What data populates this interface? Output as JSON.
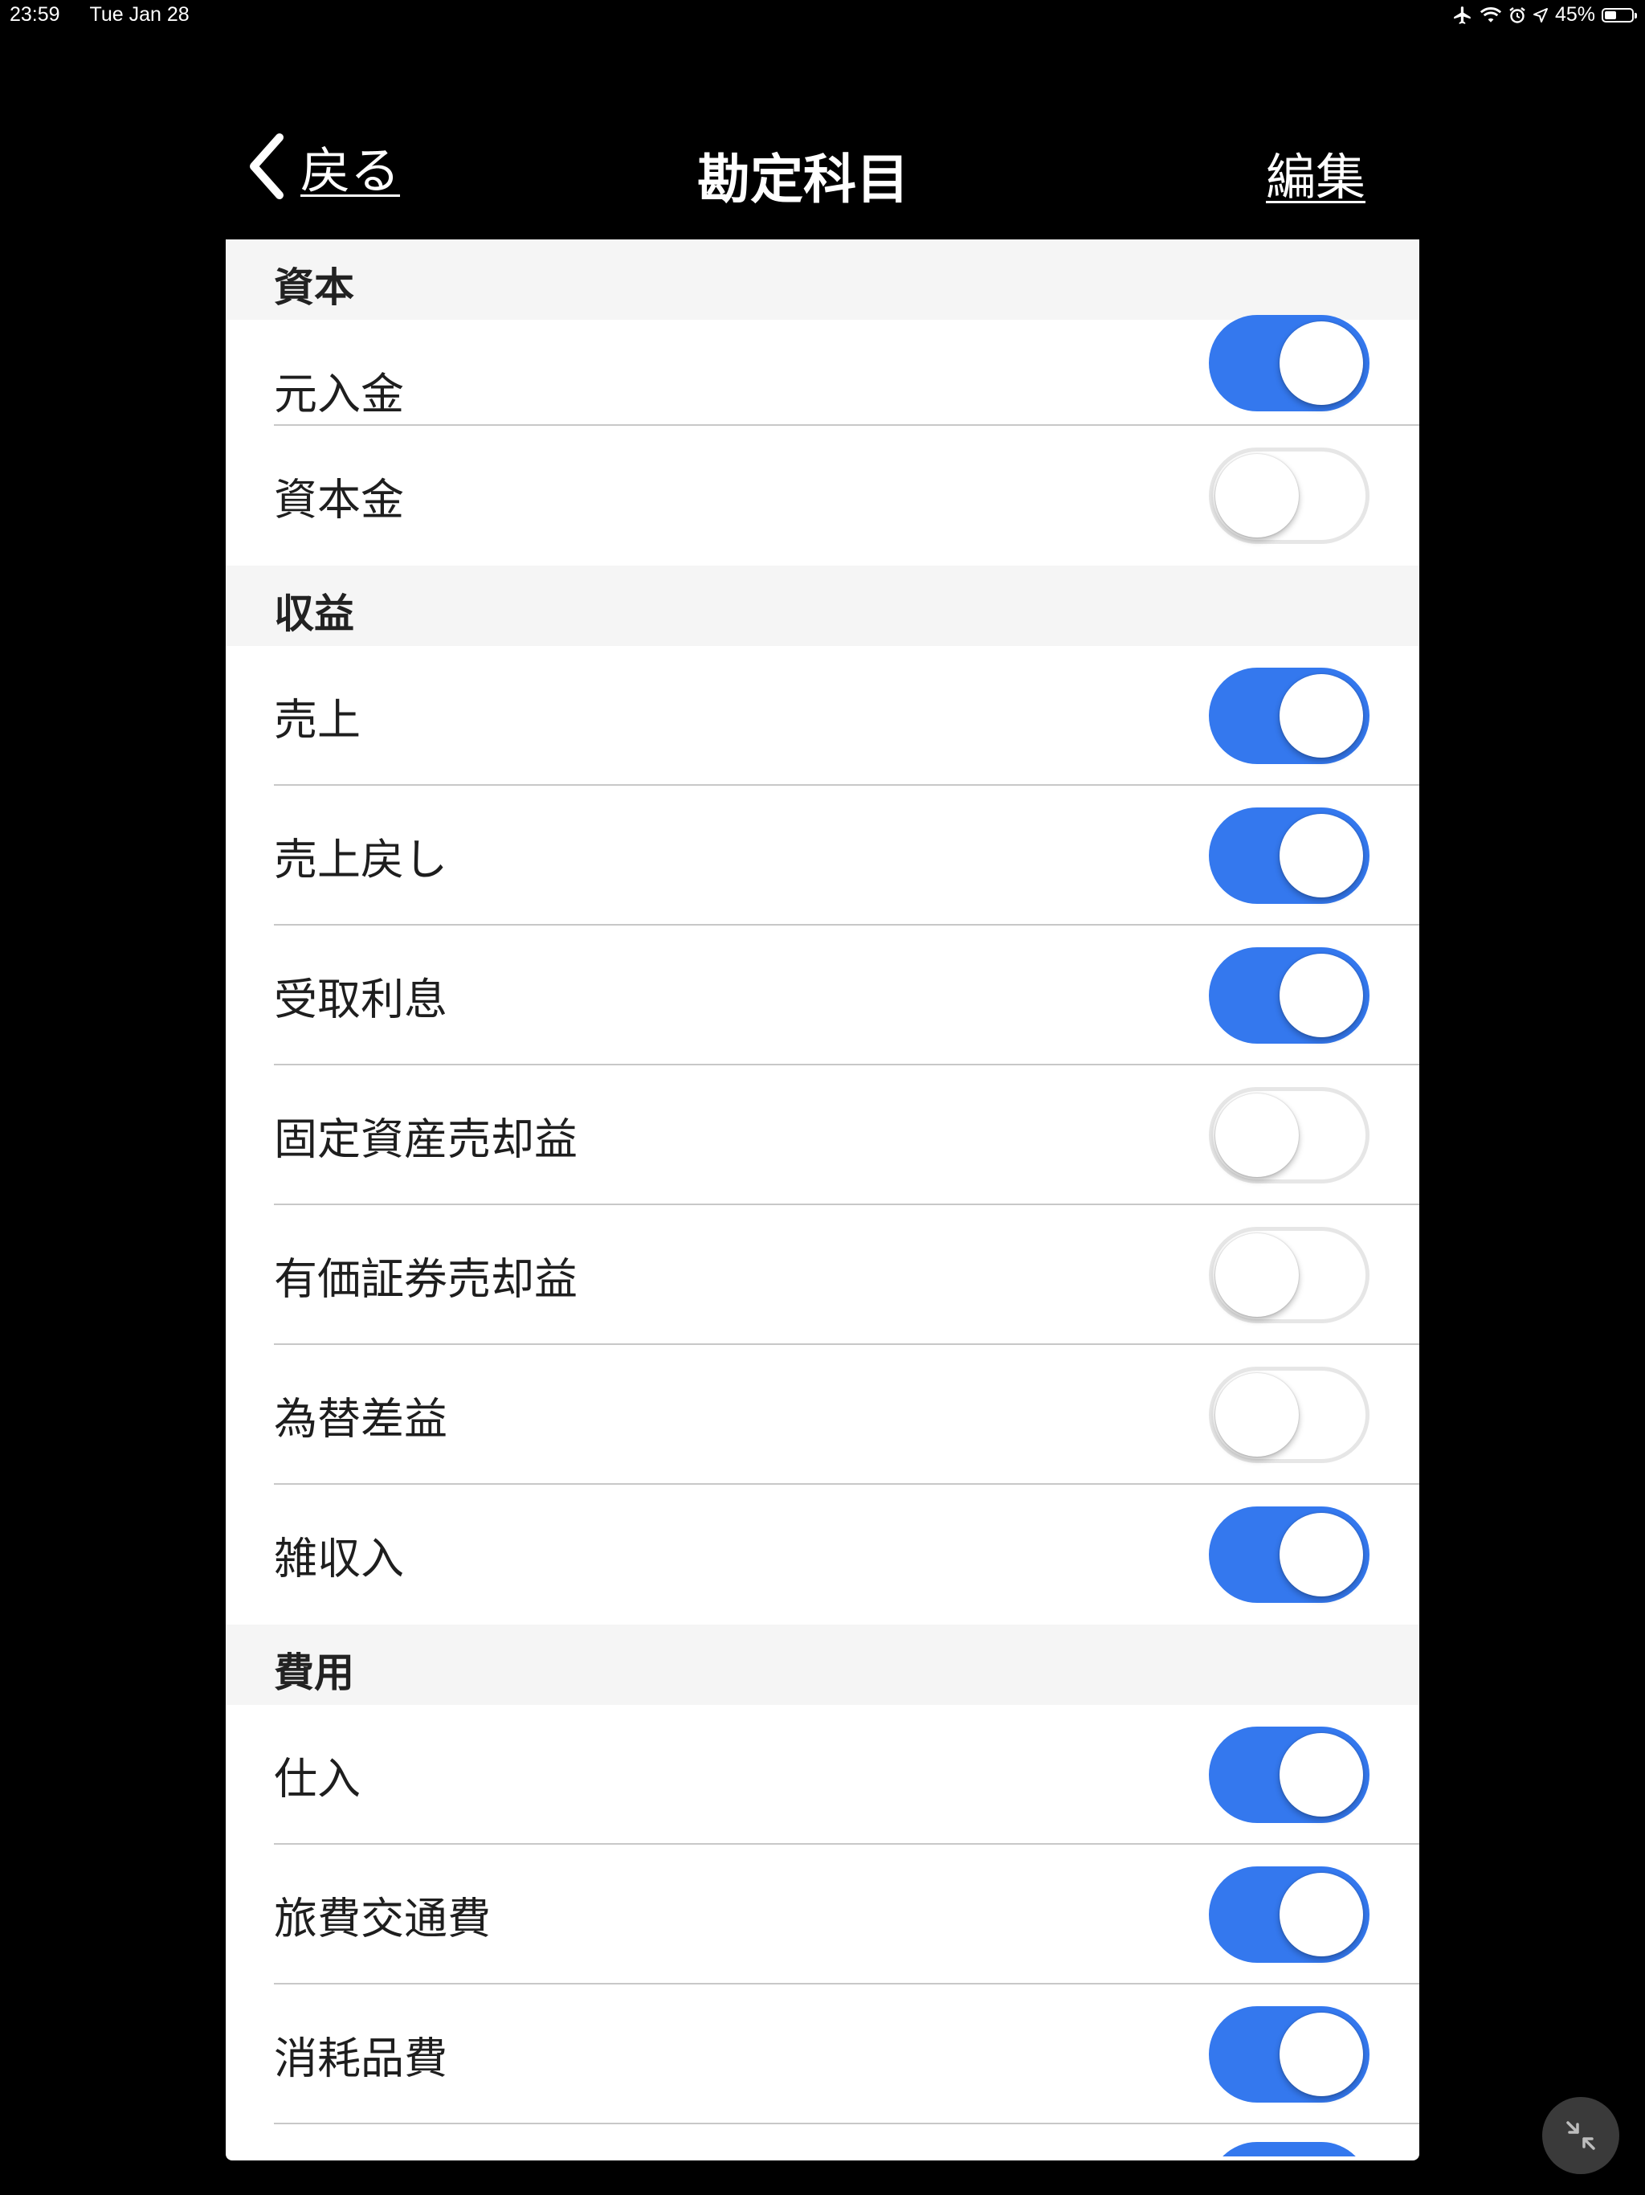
{
  "status_bar": {
    "time": "23:59",
    "date": "Tue Jan 28",
    "battery_text": "45%",
    "icons": [
      "airplane-icon",
      "wifi-icon",
      "alarm-icon",
      "location-icon",
      "battery-icon"
    ]
  },
  "nav": {
    "back_label": "戻る",
    "title": "勘定科目",
    "edit_label": "編集"
  },
  "sections": [
    {
      "header": "資本",
      "items": [
        {
          "label": "元入金",
          "on": true
        },
        {
          "label": "資本金",
          "on": false
        }
      ]
    },
    {
      "header": "収益",
      "items": [
        {
          "label": "売上",
          "on": true
        },
        {
          "label": "売上戻し",
          "on": true
        },
        {
          "label": "受取利息",
          "on": true
        },
        {
          "label": "固定資産売却益",
          "on": false
        },
        {
          "label": "有価証券売却益",
          "on": false
        },
        {
          "label": "為替差益",
          "on": false
        },
        {
          "label": "雑収入",
          "on": true
        }
      ]
    },
    {
      "header": "費用",
      "items": [
        {
          "label": "仕入",
          "on": true
        },
        {
          "label": "旅費交通費",
          "on": true
        },
        {
          "label": "消耗品費",
          "on": true
        }
      ]
    }
  ],
  "colors": {
    "toggle_on": "#3478ee",
    "background": "#000000",
    "list_background": "#ffffff",
    "section_header_background": "#f5f5f5"
  }
}
